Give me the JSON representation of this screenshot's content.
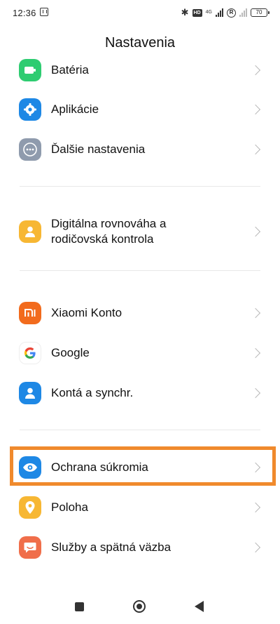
{
  "status_bar": {
    "time": "12:36",
    "bluetooth": "✱",
    "volte": "HD",
    "network": "4G",
    "roaming": "R",
    "battery": "70"
  },
  "header": {
    "title": "Nastavenia"
  },
  "items": [
    {
      "label": "Batéria",
      "icon": "battery-icon",
      "color": "#2ecc71"
    },
    {
      "label": "Aplikácie",
      "icon": "gear-icon",
      "color": "#1e88e5"
    },
    {
      "label": "Ďalšie nastavenia",
      "icon": "more-dots-icon",
      "color": "#8f9bad"
    },
    {
      "label": "Digitálna rovnováha a rodičovská kontrola",
      "icon": "person-icon",
      "color": "#f7b733"
    },
    {
      "label": "Xiaomi Konto",
      "icon": "mi-logo-icon",
      "color": "#f26b1d"
    },
    {
      "label": "Google",
      "icon": "google-icon",
      "color": "#ffffff"
    },
    {
      "label": "Kontá a synchr.",
      "icon": "account-icon",
      "color": "#1e88e5"
    },
    {
      "label": "Ochrana súkromia",
      "icon": "eye-icon",
      "color": "#1e88e5"
    },
    {
      "label": "Poloha",
      "icon": "location-pin-icon",
      "color": "#f7b733"
    },
    {
      "label": "Služby a spätná väzba",
      "icon": "feedback-icon",
      "color": "#f06e4a"
    }
  ],
  "highlight_color": "#f08a2d",
  "nav_bar": {
    "buttons": [
      "recents-icon",
      "home-icon",
      "back-icon"
    ]
  }
}
